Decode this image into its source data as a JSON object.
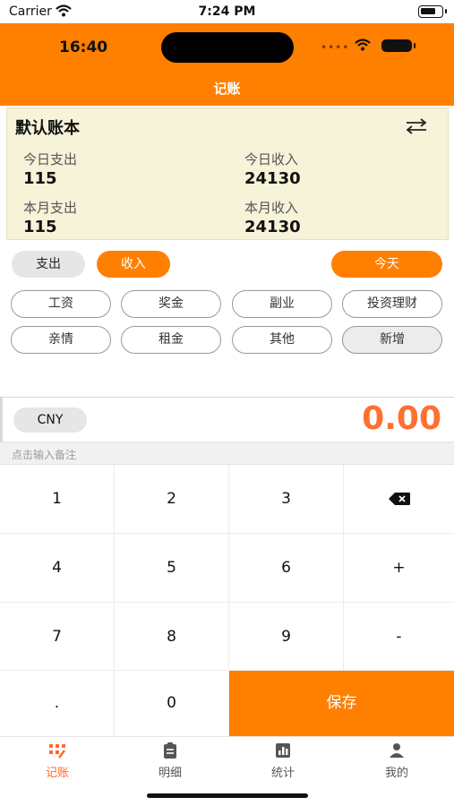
{
  "status_bar": {
    "carrier": "Carrier",
    "time": "7:24 PM"
  },
  "device_bar": {
    "time": "16:40",
    "dots": "••••"
  },
  "header": {
    "title": "记账"
  },
  "book": {
    "name": "默认账本",
    "today_expense_label": "今日支出",
    "today_expense_value": "115",
    "today_income_label": "今日收入",
    "today_income_value": "24130",
    "month_expense_label": "本月支出",
    "month_expense_value": "115",
    "month_income_label": "本月收入",
    "month_income_value": "24130"
  },
  "type_tabs": {
    "expense": "支出",
    "income": "收入",
    "selected": "收入"
  },
  "date_button": "今天",
  "categories": [
    "工资",
    "奖金",
    "副业",
    "投资理财",
    "亲情",
    "租金",
    "其他",
    "新增"
  ],
  "currency": "CNY",
  "amount": "0.00",
  "note_placeholder": "点击输入备注",
  "keypad": {
    "keys": [
      "1",
      "2",
      "3",
      "4",
      "5",
      "6",
      "+",
      "7",
      "8",
      "9",
      "-",
      ".",
      "0"
    ],
    "save": "保存",
    "delete_icon": "backspace-icon"
  },
  "tabbar": {
    "items": [
      {
        "label": "记账",
        "icon": "ledger-icon",
        "active": true
      },
      {
        "label": "明细",
        "icon": "clipboard-icon",
        "active": false
      },
      {
        "label": "统计",
        "icon": "bar-chart-icon",
        "active": false
      },
      {
        "label": "我的",
        "icon": "person-icon",
        "active": false
      }
    ]
  },
  "colors": {
    "accent": "#ff7f00",
    "amount": "#ff7030",
    "card_bg": "#f6f3d9"
  }
}
